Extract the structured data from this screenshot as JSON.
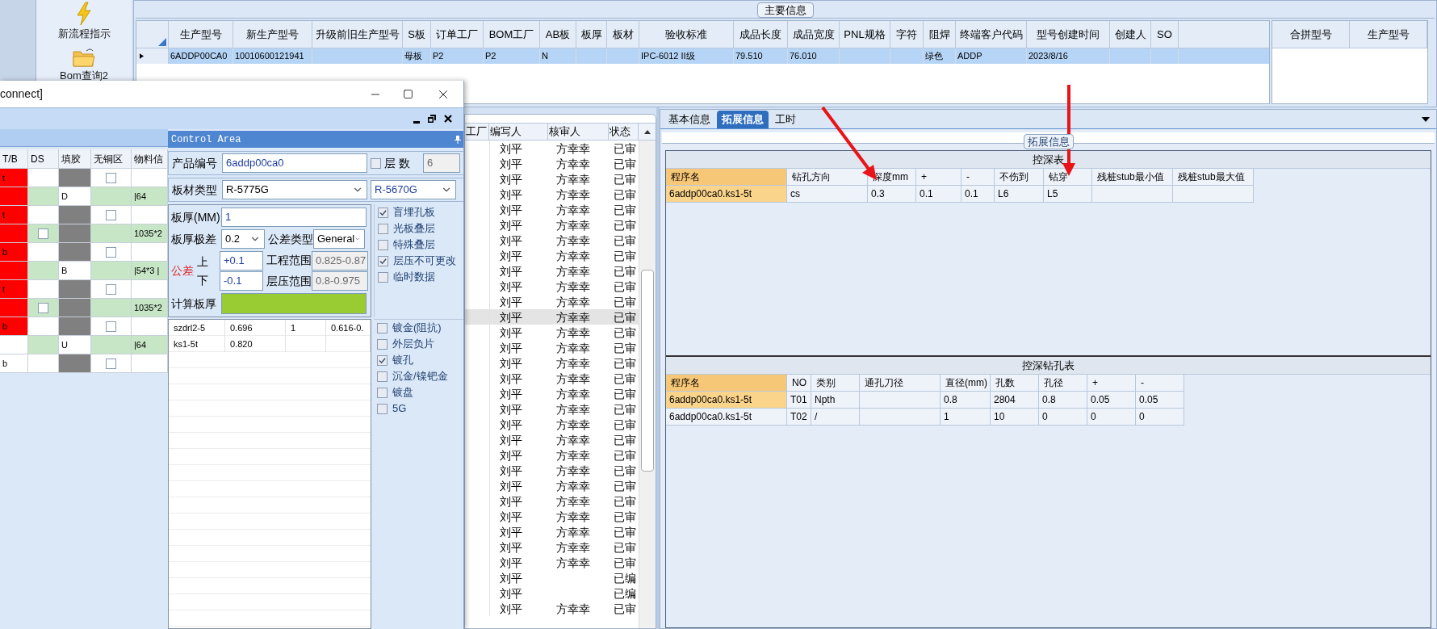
{
  "launcher": [
    {
      "kind": "bolt",
      "label": "新流程指示"
    },
    {
      "kind": "folder",
      "label": "Bom查询2"
    }
  ],
  "main_info": {
    "title": "主要信息",
    "columns": [
      "生产型号",
      "新生产型号",
      "升级前旧生产型号",
      "S板",
      "订单工厂",
      "BOM工厂",
      "AB板",
      "板厚",
      "板材",
      "验收标准",
      "成品长度",
      "成品宽度",
      "PNL规格",
      "字符",
      "阻焊",
      "终端客户代码",
      "型号创建时间",
      "创建人",
      "SO"
    ],
    "rows": [
      {
        "selected": true,
        "cells": [
          "6ADDP00CA0",
          "10010600121941",
          null,
          "母板",
          "P2",
          "P2",
          "N",
          null,
          null,
          "IPC-6012 II级",
          "79.510",
          "76.010",
          null,
          null,
          "绿色",
          "ADDP",
          "2023/8/16",
          null,
          null
        ]
      }
    ],
    "merge_columns": [
      "合拼型号",
      "生产型号"
    ]
  },
  "list": {
    "columns": [
      "工厂",
      "编写人",
      "核审人",
      "状态"
    ],
    "rows": [
      {
        "writer": "刘平",
        "reviewer": "方幸幸",
        "status": "已审",
        "selected": false
      },
      {
        "writer": "刘平",
        "reviewer": "方幸幸",
        "status": "已审",
        "selected": false
      },
      {
        "writer": "刘平",
        "reviewer": "方幸幸",
        "status": "已审",
        "selected": false
      },
      {
        "writer": "刘平",
        "reviewer": "方幸幸",
        "status": "已审",
        "selected": false
      },
      {
        "writer": "刘平",
        "reviewer": "方幸幸",
        "status": "已审",
        "selected": false
      },
      {
        "writer": "刘平",
        "reviewer": "方幸幸",
        "status": "已审",
        "selected": false
      },
      {
        "writer": "刘平",
        "reviewer": "方幸幸",
        "status": "已审",
        "selected": false
      },
      {
        "writer": "刘平",
        "reviewer": "方幸幸",
        "status": "已审",
        "selected": false
      },
      {
        "writer": "刘平",
        "reviewer": "方幸幸",
        "status": "已审",
        "selected": false
      },
      {
        "writer": "刘平",
        "reviewer": "方幸幸",
        "status": "已审",
        "selected": false
      },
      {
        "writer": "刘平",
        "reviewer": "方幸幸",
        "status": "已审",
        "selected": false
      },
      {
        "writer": "刘平",
        "reviewer": "方幸幸",
        "status": "已审",
        "selected": true
      },
      {
        "writer": "刘平",
        "reviewer": "方幸幸",
        "status": "已审",
        "selected": false
      },
      {
        "writer": "刘平",
        "reviewer": "方幸幸",
        "status": "已审",
        "selected": false
      },
      {
        "writer": "刘平",
        "reviewer": "方幸幸",
        "status": "已审",
        "selected": false
      },
      {
        "writer": "刘平",
        "reviewer": "方幸幸",
        "status": "已审",
        "selected": false
      },
      {
        "writer": "刘平",
        "reviewer": "方幸幸",
        "status": "已审",
        "selected": false
      },
      {
        "writer": "刘平",
        "reviewer": "方幸幸",
        "status": "已审",
        "selected": false
      },
      {
        "writer": "刘平",
        "reviewer": "方幸幸",
        "status": "已审",
        "selected": false
      },
      {
        "writer": "刘平",
        "reviewer": "方幸幸",
        "status": "已审",
        "selected": false
      },
      {
        "writer": "刘平",
        "reviewer": "方幸幸",
        "status": "已审",
        "selected": false
      },
      {
        "writer": "刘平",
        "reviewer": "方幸幸",
        "status": "已审",
        "selected": false
      },
      {
        "writer": "刘平",
        "reviewer": "方幸幸",
        "status": "已审",
        "selected": false
      },
      {
        "writer": "刘平",
        "reviewer": "方幸幸",
        "status": "已审",
        "selected": false
      },
      {
        "writer": "刘平",
        "reviewer": "方幸幸",
        "status": "已审",
        "selected": false
      },
      {
        "writer": "刘平",
        "reviewer": "方幸幸",
        "status": "已审",
        "selected": false
      },
      {
        "writer": "刘平",
        "reviewer": "方幸幸",
        "status": "已审",
        "selected": false
      },
      {
        "writer": "刘平",
        "reviewer": "方幸幸",
        "status": "已审",
        "selected": false
      },
      {
        "writer": "刘平",
        "status": "已编",
        "selected": false
      },
      {
        "writer": "刘平",
        "status": "已编",
        "selected": false
      },
      {
        "writer": "刘平",
        "reviewer": "方幸幸",
        "status": "已审",
        "selected": false
      }
    ]
  },
  "right": {
    "tabs": [
      {
        "label": "基本信息",
        "selected": false
      },
      {
        "label": "拓展信息",
        "selected": true
      },
      {
        "label": "工时",
        "selected": false
      }
    ],
    "group_title": "拓展信息",
    "tables": [
      {
        "title": "控深表",
        "columns": [
          "程序名",
          "钻孔方向",
          "深度mm",
          "+",
          "-",
          "不伤到",
          "钻穿",
          "残桩stub最小值",
          "残桩stub最大值"
        ],
        "rows": [
          {
            "selected": true,
            "cells": [
              "6addp00ca0.ks1-5t",
              "cs",
              "0.3",
              "0.1",
              "0.1",
              "L6",
              "L5",
              null,
              null
            ]
          }
        ]
      },
      {
        "title": "控深钻孔表",
        "columns": [
          "程序名",
          "NO",
          "类别",
          "通孔刀径",
          "直径(mm)",
          "孔数",
          "孔径",
          "+",
          "-"
        ],
        "rows": [
          {
            "selected": true,
            "cells": [
              "6addp00ca0.ks1-5t",
              "T01",
              "Npth",
              null,
              "0.8",
              "2804",
              "0.8",
              "0.05",
              "0.05"
            ]
          },
          {
            "selected": false,
            "cells": [
              "6addp00ca0.ks1-5t",
              "T02",
              "/",
              null,
              "1",
              "10",
              "0",
              "0",
              "0"
            ]
          }
        ]
      }
    ]
  },
  "window": {
    "title": "connect]",
    "grid": {
      "columns": [
        "T/B",
        "DS",
        "填胶",
        "无铜区",
        "物料信"
      ],
      "rows": [
        [
          {
            "kind": "text",
            "color": "#ff0000",
            "text": "t"
          },
          {
            "kind": "text",
            "color": "#ffffff"
          },
          {
            "kind": "block"
          },
          {
            "kind": "check",
            "color": "#ffffff",
            "checked": false
          },
          {
            "kind": "text",
            "color": "#ffffff"
          }
        ],
        [
          {
            "kind": "text",
            "color": "#ff0000"
          },
          {
            "kind": "text",
            "color": "#c6e6c6"
          },
          {
            "kind": "text",
            "color": "#ffffff",
            "text": "D"
          },
          {
            "kind": "text",
            "color": "#c6e6c6"
          },
          {
            "kind": "text",
            "color": "#c6e6c6",
            "text": "|64"
          }
        ],
        [
          {
            "kind": "text",
            "color": "#ff0000",
            "text": "t"
          },
          {
            "kind": "text",
            "color": "#ffffff"
          },
          {
            "kind": "block"
          },
          {
            "kind": "check",
            "color": "#ffffff",
            "checked": false
          },
          {
            "kind": "text",
            "color": "#ffffff"
          }
        ],
        [
          {
            "kind": "text",
            "color": "#ff0000"
          },
          {
            "kind": "check",
            "color": "#c6e6c6",
            "checked": false
          },
          {
            "kind": "block"
          },
          {
            "kind": "text",
            "color": "#c6e6c6"
          },
          {
            "kind": "text",
            "color": "#c6e6c6",
            "text": "1035*2"
          }
        ],
        [
          {
            "kind": "text",
            "color": "#ff0000",
            "text": "b"
          },
          {
            "kind": "text",
            "color": "#ffffff"
          },
          {
            "kind": "block"
          },
          {
            "kind": "check",
            "color": "#ffffff",
            "checked": false
          },
          {
            "kind": "text",
            "color": "#ffffff"
          }
        ],
        [
          {
            "kind": "text",
            "color": "#ff0000"
          },
          {
            "kind": "text",
            "color": "#c6e6c6"
          },
          {
            "kind": "text",
            "color": "#ffffff",
            "text": "B"
          },
          {
            "kind": "text",
            "color": "#c6e6c6"
          },
          {
            "kind": "text",
            "color": "#c6e6c6",
            "text": "|54*3 |"
          }
        ],
        [
          {
            "kind": "text",
            "color": "#ff0000",
            "text": "t"
          },
          {
            "kind": "text",
            "color": "#ffffff"
          },
          {
            "kind": "block"
          },
          {
            "kind": "check",
            "color": "#ffffff",
            "checked": false
          },
          {
            "kind": "text",
            "color": "#ffffff"
          }
        ],
        [
          {
            "kind": "text",
            "color": "#ff0000"
          },
          {
            "kind": "check",
            "color": "#c6e6c6",
            "checked": false
          },
          {
            "kind": "block"
          },
          {
            "kind": "text",
            "color": "#c6e6c6"
          },
          {
            "kind": "text",
            "color": "#c6e6c6",
            "text": "1035*2"
          }
        ],
        [
          {
            "kind": "text",
            "color": "#ff0000",
            "text": "b"
          },
          {
            "kind": "text",
            "color": "#ffffff"
          },
          {
            "kind": "block"
          },
          {
            "kind": "check",
            "color": "#ffffff",
            "checked": false
          },
          {
            "kind": "text",
            "color": "#ffffff"
          }
        ],
        [
          {
            "kind": "text",
            "color": "#ffffff"
          },
          {
            "kind": "text",
            "color": "#c6e6c6"
          },
          {
            "kind": "text",
            "color": "#ffffff",
            "text": "U"
          },
          {
            "kind": "text",
            "color": "#c6e6c6"
          },
          {
            "kind": "text",
            "color": "#c6e6c6",
            "text": "|64"
          }
        ],
        [
          {
            "kind": "text",
            "color": "#ffffff",
            "text": "b"
          },
          {
            "kind": "text",
            "color": "#ffffff"
          },
          {
            "kind": "block"
          },
          {
            "kind": "check",
            "color": "#ffffff",
            "checked": false
          },
          {
            "kind": "text",
            "color": "#ffffff"
          }
        ]
      ]
    },
    "control_area": {
      "title": "Control Area",
      "product": {
        "label": "产品编号",
        "value": "6addp00ca0"
      },
      "layers": {
        "label": "层 数",
        "checked": false,
        "value": "6"
      },
      "material": {
        "label": "板材类型",
        "value": "R-5775G",
        "value2": "R-5670G"
      },
      "thickness": {
        "label": "板厚(MM)",
        "value": "1"
      },
      "thickness_tol": {
        "label": "板厚极差",
        "value": "0.2"
      },
      "tol_type": {
        "label": "公差类型",
        "value": "General"
      },
      "tolerance": {
        "label": "公差",
        "upper_label": "上",
        "upper": "+0.1",
        "lower_label": "下",
        "lower": "-0.1"
      },
      "eng_range": {
        "label": "工程范围",
        "value": "0.825-0.87"
      },
      "press_range": {
        "label": "层压范围",
        "value": "0.8-0.975"
      },
      "calc": {
        "label": "计算板厚"
      },
      "options_a": [
        {
          "label": "盲埋孔板",
          "checked": true
        },
        {
          "label": "光板叠层",
          "checked": false
        },
        {
          "label": "特殊叠层",
          "checked": false
        },
        {
          "label": "层压不可更改",
          "checked": true
        },
        {
          "label": "临时数据",
          "checked": false
        }
      ],
      "options_b": [
        {
          "label": "镀金(阻抗)",
          "checked": false
        },
        {
          "label": "外层负片",
          "checked": false
        },
        {
          "label": "镀孔",
          "checked": true
        },
        {
          "label": "沉金/镍钯金",
          "checked": false
        },
        {
          "label": "镀盘",
          "checked": false
        },
        {
          "label": "5G",
          "checked": false
        }
      ],
      "results": [
        [
          "szdrl2-5",
          "0.696",
          "1",
          "0.616-0."
        ],
        [
          "ks1-5t",
          "0.820"
        ]
      ]
    }
  }
}
